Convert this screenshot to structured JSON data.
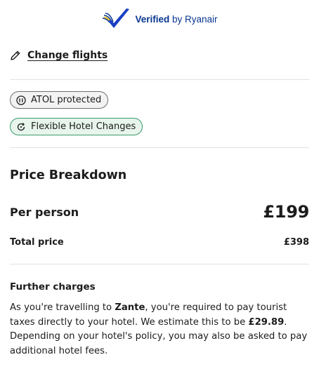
{
  "verified": {
    "bold": "Verified",
    "rest": " by Ryanair",
    "icon": "ryanair-harp-check-icon"
  },
  "change_flights": {
    "label": "Change flights",
    "icon": "pencil-icon"
  },
  "badges": [
    {
      "label": "ATOL protected",
      "icon": "atol-icon",
      "style": "grey"
    },
    {
      "label": "Flexible Hotel Changes",
      "icon": "refresh-icon",
      "style": "green"
    }
  ],
  "price_breakdown": {
    "title": "Price Breakdown",
    "per_person_label": "Per person",
    "per_person_value": "£199",
    "total_label": "Total price",
    "total_value": "£398"
  },
  "further_charges": {
    "title": "Further charges",
    "text_1": "As you're travelling to ",
    "destination": "Zante",
    "text_2": ", you're required to pay tourist taxes directly to your hotel. We estimate this to be ",
    "estimate": "£29.89",
    "text_3": ". Depending on your hotel's policy, you may also be asked to pay additional hotel fees."
  },
  "colors": {
    "ryanair_blue": "#073590",
    "check_blue": "#1a3fc4",
    "green_border": "#3a9a6c",
    "green_bg": "#e7f5ec"
  }
}
